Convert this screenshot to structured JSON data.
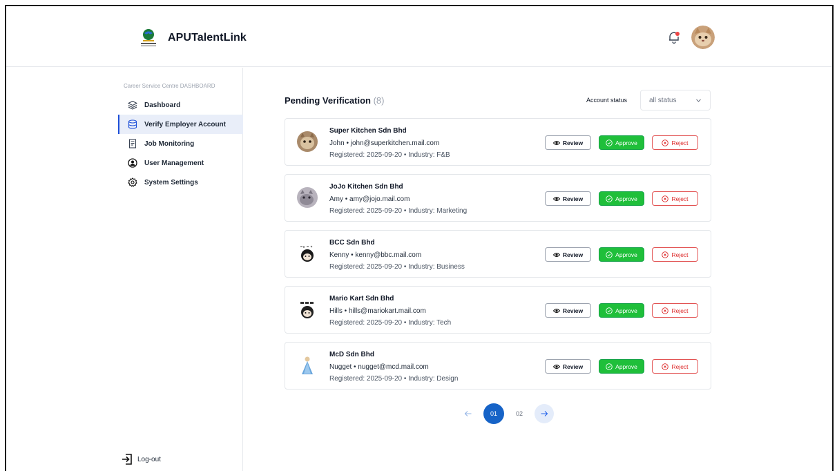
{
  "header": {
    "app_name": "APUTalentLink",
    "logo_icon": "apu-logo",
    "notification_icon": "bell-alert-icon",
    "notification_dot_color": "#ef4444"
  },
  "sidebar": {
    "caption": "Career Service Centre DASHBOARD",
    "items": [
      {
        "label": "Dashboard",
        "icon": "layers-icon",
        "active": false
      },
      {
        "label": "Verify Employer Account",
        "icon": "database-icon",
        "active": true
      },
      {
        "label": "Job Monitoring",
        "icon": "document-icon",
        "active": false
      },
      {
        "label": "User Management",
        "icon": "user-circle-icon",
        "active": false
      },
      {
        "label": "System Settings",
        "icon": "gear-icon",
        "active": false
      }
    ],
    "logout_label": "Log-out"
  },
  "main": {
    "title": "Pending Verification",
    "count": "(8)",
    "status_label": "Account status",
    "status_value": "all status",
    "buttons": {
      "review": "Review",
      "approve": "Approve",
      "reject": "Reject"
    },
    "employers": [
      {
        "company": "Super Kitchen Sdn Bhd",
        "contact": "John • john@superkitchen.mail.com",
        "meta": "Registered: 2025-09-20 • Industry: F&B"
      },
      {
        "company": "JoJo Kitchen Sdn Bhd",
        "contact": "Amy • amy@jojo.mail.com",
        "meta": "Registered: 2025-09-20 • Industry: Marketing"
      },
      {
        "company": "BCC Sdn Bhd",
        "contact": "Kenny • kenny@bbc.mail.com",
        "meta": "Registered: 2025-09-20 • Industry: Business"
      },
      {
        "company": "Mario Kart Sdn Bhd",
        "contact": "Hills • hills@mariokart.mail.com",
        "meta": "Registered: 2025-09-20 • Industry: Tech"
      },
      {
        "company": "McD Sdn Bhd",
        "contact": "Nugget • nugget@mcd.mail.com",
        "meta": "Registered: 2025-09-20 • Industry: Design"
      }
    ],
    "pagination": {
      "pages": [
        "01",
        "02"
      ],
      "current": "01"
    }
  },
  "colors": {
    "accent": "#1663c7",
    "approve": "#1fbf3a",
    "reject": "#dc2626",
    "active_nav_bg": "#e9eef9"
  }
}
